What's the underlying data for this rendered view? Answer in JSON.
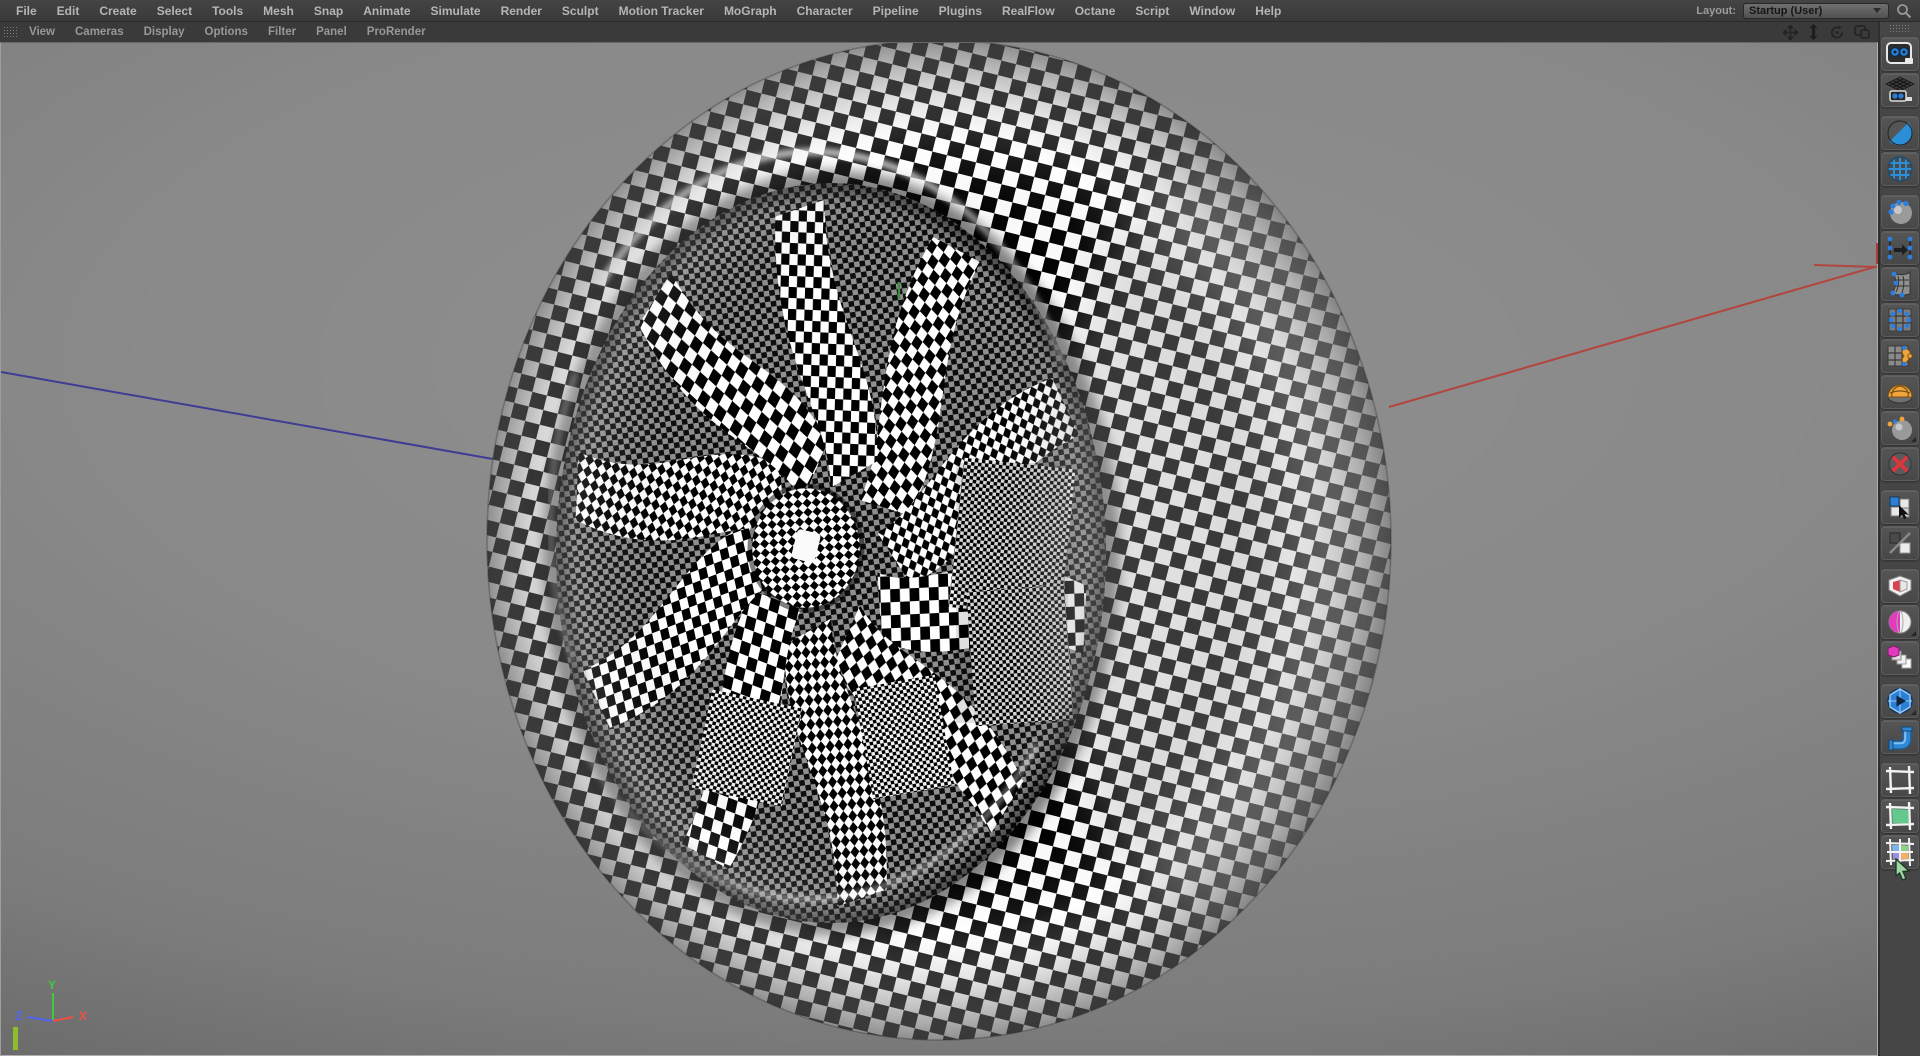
{
  "menubar": {
    "items": [
      "File",
      "Edit",
      "Create",
      "Select",
      "Tools",
      "Mesh",
      "Snap",
      "Animate",
      "Simulate",
      "Render",
      "Sculpt",
      "Motion Tracker",
      "MoGraph",
      "Character",
      "Pipeline",
      "Plugins",
      "RealFlow",
      "Octane",
      "Script",
      "Window",
      "Help"
    ],
    "layout_label": "Layout:",
    "layout_value": "Startup (User)"
  },
  "viewport_menubar": {
    "items": [
      "View",
      "Cameras",
      "Display",
      "Options",
      "Filter",
      "Panel",
      "ProRender"
    ]
  },
  "viewport_controls": {
    "icons": [
      "pan-view-icon",
      "dolly-view-icon",
      "rotate-view-icon",
      "toggle-panels-icon"
    ]
  },
  "axes": {
    "x_color": "#b3453f",
    "y_color": "#3f8f3f",
    "z_color": "#3d3d94"
  },
  "axis_gizmo": {
    "x_label": "X",
    "y_label": "Y",
    "z_label": "Z",
    "x_color": "#ee4f44",
    "y_color": "#3ecb3e",
    "z_color": "#4f63f0",
    "bar_color": "#8fbe2d"
  },
  "sidebar": {
    "icons": [
      "render-view-camera",
      "render-to-picture-viewer",
      "edit-render-settings",
      "interactive-render-region",
      "point-selection-sphere",
      "transfer-selection",
      "soft-selection-surface",
      "lattice-point-ring",
      "ffd-grid-points",
      "paint-surface",
      "tangent-handle-sphere",
      "delete-command",
      "select-child-cubes",
      "toggle-visibility-cubes",
      "open-volume-cube",
      "split-sphere",
      "duplicate-array-cubes",
      "prorender-start",
      "pipe-primitive",
      "uv-polygon-frame",
      "uv-polygon-fill",
      "uv-grid-colored"
    ]
  },
  "scene": {
    "object": "checkerboard-textured wheel",
    "checker_black": "#000000",
    "checker_white": "#ffffff"
  }
}
